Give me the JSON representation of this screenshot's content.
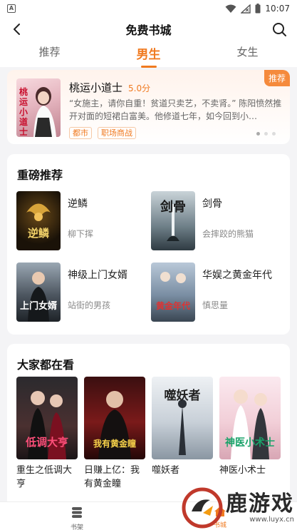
{
  "status": {
    "time": "10:07"
  },
  "header": {
    "title": "免费书城"
  },
  "tabs": [
    {
      "label": "推荐",
      "active": false
    },
    {
      "label": "男生",
      "active": true
    },
    {
      "label": "女生",
      "active": false
    }
  ],
  "banner": {
    "tag": "推荐",
    "title": "桃运小道士",
    "score": "5.0分",
    "description": "“女施主，请你自重！贫道只卖艺，不卖肾。” 陈阳愤然推开对面的短裙白富美。他修道七年，如今回到小…",
    "tags": [
      "都市",
      "职场商战"
    ],
    "cover_text": "桃运小道士"
  },
  "featured": {
    "title": "重磅推荐",
    "books": [
      {
        "title": "逆鳞",
        "author": "柳下挥",
        "cover_text": "逆鳞"
      },
      {
        "title": "剑骨",
        "author": "会摔跤的熊猫",
        "cover_text": "剑骨"
      },
      {
        "title": "神级上门女婿",
        "author": "站街的男孩",
        "cover_text": "上门女婿"
      },
      {
        "title": "华娱之黄金年代",
        "author": "慎思量",
        "cover_text": "黄金年代"
      }
    ]
  },
  "popular": {
    "title": "大家都在看",
    "books": [
      {
        "title": "重生之低调大亨",
        "cover_text": "低调大亨"
      },
      {
        "title": "日赚上亿：我有黄金瞳",
        "cover_text": "我有黄金瞳"
      },
      {
        "title": "噬妖者",
        "cover_text": "噬妖者"
      },
      {
        "title": "神医小术士",
        "cover_text": "神医小术士"
      }
    ]
  },
  "bottom_nav": {
    "shelf": "书架",
    "store": "书城"
  },
  "watermark": {
    "text": "鹿游戏",
    "url": "www.luyx.cn"
  },
  "colors": {
    "accent": "#f07a20",
    "background": "#f4f4f6"
  }
}
